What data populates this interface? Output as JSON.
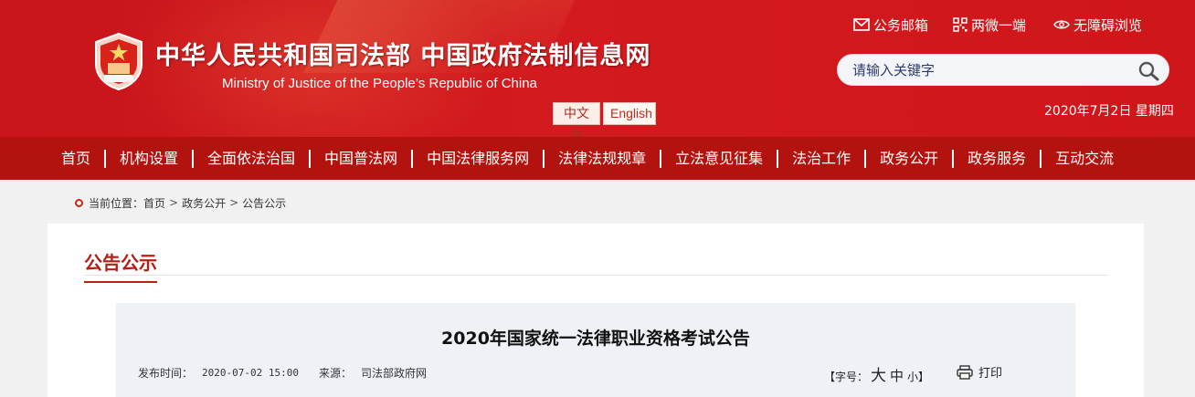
{
  "header": {
    "title_cn": "中华人民共和国司法部  中国政府法制信息网",
    "title_en": "Ministry of Justice of the People’s Republic of China",
    "lang_cn": "中文版",
    "lang_en": "English",
    "links": {
      "mail": "公务邮箱",
      "qr": "两微一端",
      "accessibility": "无障碍浏览"
    },
    "search_placeholder": "请输入关键字",
    "date": "2020年7月2日  星期四",
    "colors": {
      "primary_red": "#c8141a",
      "nav_red": "#b3130f"
    }
  },
  "nav": {
    "items": [
      "首页",
      "机构设置",
      "全面依法治国",
      "中国普法网",
      "中国法律服务网",
      "法律法规规章",
      "立法意见征集",
      "法治工作",
      "政务公开",
      "政务服务",
      "互动交流"
    ]
  },
  "breadcrumb": {
    "label": "当前位置：",
    "items": [
      "首页",
      "政务公开",
      "公告公示"
    ]
  },
  "section": {
    "title": "公告公示"
  },
  "article": {
    "title": "2020年国家统一法律职业资格考试公告",
    "time_label": "发布时间：",
    "time_value": "2020-07-02 15:00",
    "source_label": "来源：",
    "source_value": "司法部政府网",
    "fontsize_label": "【字号：",
    "size_big": "大",
    "size_mid": "中",
    "size_small": "小",
    "fontsize_close": "】",
    "print_label": "打印"
  }
}
